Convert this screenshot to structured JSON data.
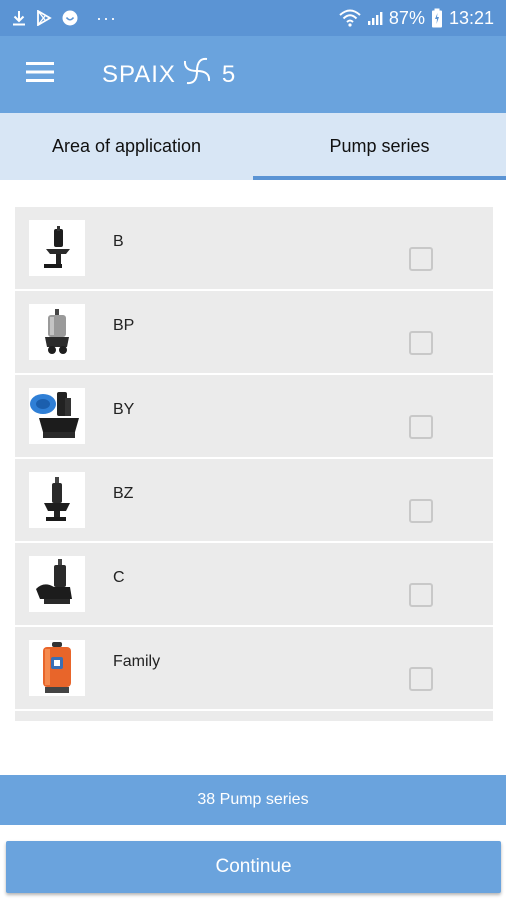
{
  "status_bar": {
    "battery": "87%",
    "time": "13:21",
    "dots": "···"
  },
  "app_bar": {
    "logo_text": "SPAIX",
    "version": "5"
  },
  "tabs": [
    {
      "label": "Area of application",
      "active": false
    },
    {
      "label": "Pump series",
      "active": true
    }
  ],
  "pump_series": [
    {
      "label": "B",
      "checked": false,
      "icon": "pump-b-image"
    },
    {
      "label": "BP",
      "checked": false,
      "icon": "pump-bp-image"
    },
    {
      "label": "BY",
      "checked": false,
      "icon": "pump-by-image"
    },
    {
      "label": "BZ",
      "checked": false,
      "icon": "pump-bz-image"
    },
    {
      "label": "C",
      "checked": false,
      "icon": "pump-c-image"
    },
    {
      "label": "Family",
      "checked": false,
      "icon": "pump-family-image"
    }
  ],
  "count_label": "38 Pump series",
  "continue_label": "Continue",
  "colors": {
    "status_bar": "#5b94d4",
    "app_bar": "#6aa3dd",
    "tab_bg": "#d8e6f5",
    "list_bg": "#ebebeb"
  }
}
